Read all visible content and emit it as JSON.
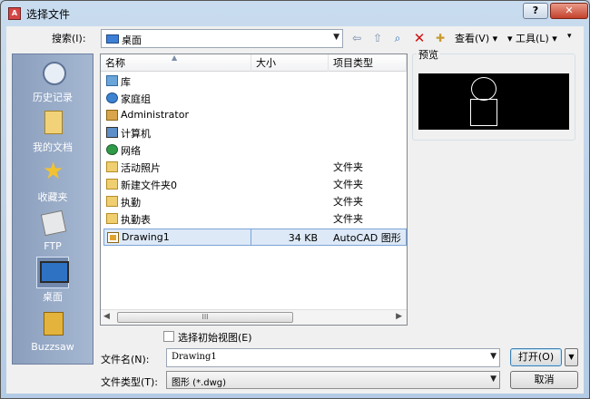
{
  "window": {
    "title": "选择文件",
    "help_label": "?",
    "close_label": "✕"
  },
  "toolbar": {
    "lookin_label": "搜索(I):",
    "lookin_value": "桌面",
    "views_label": "查看(V) ▾",
    "tools_label": "▾ 工具(L) ▾",
    "more_label": "▾",
    "icons": [
      "back-icon",
      "up-folder-icon",
      "search-web-icon",
      "delete-icon",
      "new-folder-icon"
    ]
  },
  "places": [
    {
      "label": "历史记录",
      "icon": "history-icon"
    },
    {
      "label": "我的文档",
      "icon": "documents-icon"
    },
    {
      "label": "收藏夹",
      "icon": "favorites-icon"
    },
    {
      "label": "FTP",
      "icon": "ftp-icon"
    },
    {
      "label": "桌面",
      "icon": "desktop-icon",
      "selected": true
    },
    {
      "label": "Buzzsaw",
      "icon": "buzzsaw-icon"
    }
  ],
  "filelist": {
    "columns": {
      "name": "名称",
      "size": "大小",
      "type": "项目类型"
    },
    "rows": [
      {
        "name": "库",
        "size": "",
        "type": "",
        "icon": "library-icon"
      },
      {
        "name": "家庭组",
        "size": "",
        "type": "",
        "icon": "homegroup-icon"
      },
      {
        "name": "Administrator",
        "size": "",
        "type": "",
        "icon": "user-folder-icon"
      },
      {
        "name": "计算机",
        "size": "",
        "type": "",
        "icon": "computer-icon"
      },
      {
        "name": "网络",
        "size": "",
        "type": "",
        "icon": "network-icon"
      },
      {
        "name": "活动照片",
        "size": "",
        "type": "文件夹",
        "icon": "folder-icon"
      },
      {
        "name": "新建文件夹0",
        "size": "",
        "type": "文件夹",
        "icon": "folder-icon"
      },
      {
        "name": "执勤",
        "size": "",
        "type": "文件夹",
        "icon": "folder-icon"
      },
      {
        "name": "执勤表",
        "size": "",
        "type": "文件夹",
        "icon": "folder-icon"
      },
      {
        "name": "Drawing1",
        "size": "34 KB",
        "type": "AutoCAD 图形",
        "icon": "dwg-file-icon",
        "selected": true
      }
    ],
    "scrollbar_thumb_label": "III"
  },
  "preview": {
    "title": "预览"
  },
  "options": {
    "initial_view_label": "选择初始视图(E)"
  },
  "form": {
    "filename_label": "文件名(N):",
    "filename_value": "Drawing1",
    "filetype_label": "文件类型(T):",
    "filetype_value": "图形 (*.dwg)",
    "open_label": "打开(O)",
    "cancel_label": "取消"
  }
}
